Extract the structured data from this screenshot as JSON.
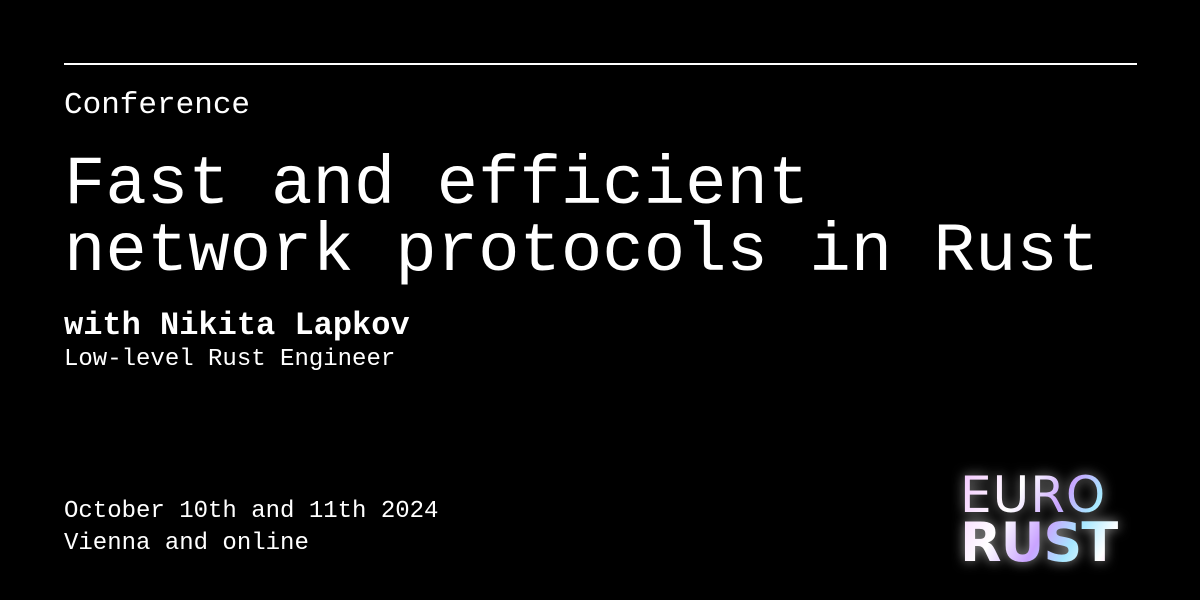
{
  "category": "Conference",
  "title_lines": [
    "Fast and efficient",
    "network protocols in Rust"
  ],
  "speaker": "with Nikita Lapkov",
  "role": "Low-level Rust Engineer",
  "date": "October 10th and 11th 2024",
  "location": "Vienna and online",
  "logo": {
    "line1": "EURO",
    "line2": "RUST"
  }
}
